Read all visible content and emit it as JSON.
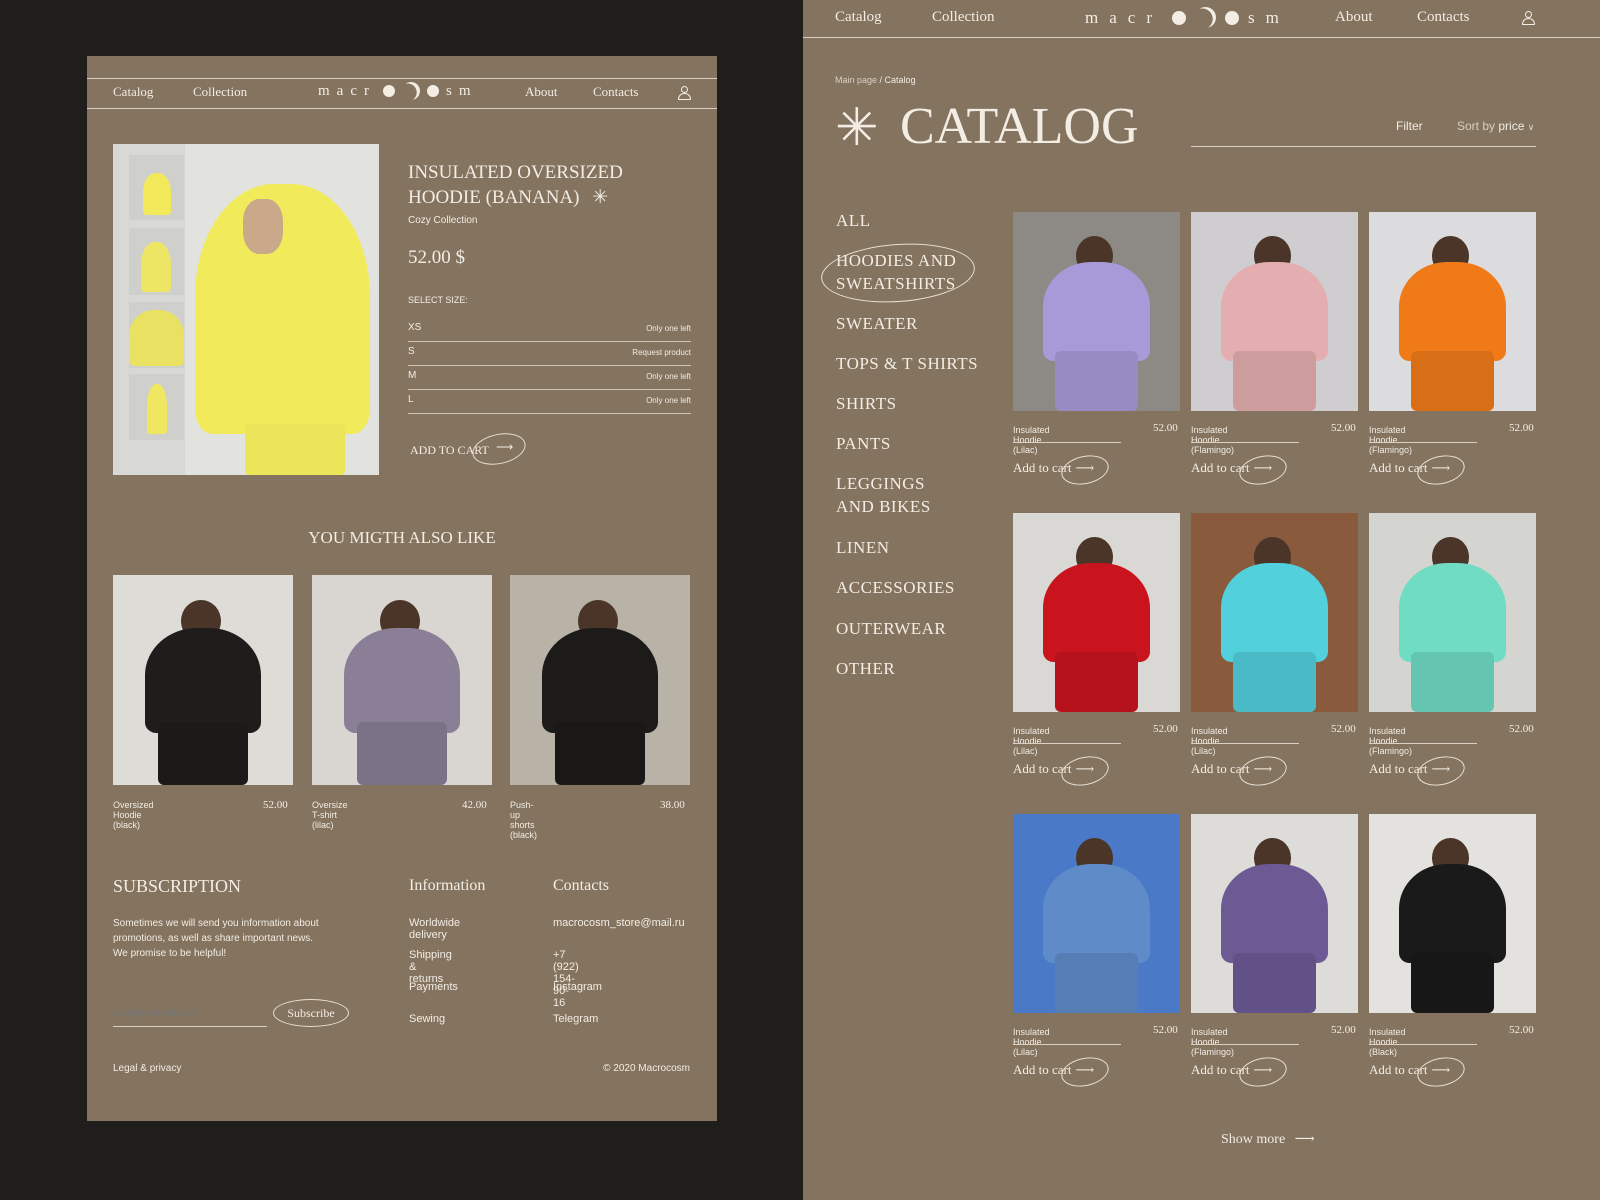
{
  "colors": {
    "background": "#1f1e1d",
    "panel": "#83735f",
    "text": "#f3ede4"
  },
  "nav": {
    "catalog": "Catalog",
    "collection": "Collection",
    "about": "About",
    "contacts": "Contacts",
    "logo_left": "macr",
    "logo_right": "sm",
    "user_icon": "user-icon"
  },
  "product": {
    "title_line1": "INSULATED OVERSIZED",
    "title_line2": "HOODIE (BANANA)",
    "collection": "Cozy Collection",
    "price": "52.00 $",
    "select_size": "SELECT SIZE:",
    "sizes": [
      {
        "size": "XS",
        "status": "Only one left"
      },
      {
        "size": "S",
        "status": "Request product"
      },
      {
        "size": "M",
        "status": "Only one left"
      },
      {
        "size": "L",
        "status": "Only one left"
      }
    ],
    "add_to_cart": "ADD TO CART"
  },
  "also_like": {
    "title": "YOU MIGTH ALSO LIKE",
    "items": [
      {
        "name": "Oversized Hoodie (black)",
        "price": "52.00",
        "color": "#1e1d1c",
        "bg": "#dedcd7"
      },
      {
        "name": "Oversize T-shirt (lilac)",
        "price": "42.00",
        "color": "#8a7f96",
        "bg": "#d9d6d2"
      },
      {
        "name": "Push-up shorts (black)",
        "price": "38.00",
        "color": "#1c1b1a",
        "bg": "#b9b2a6"
      }
    ]
  },
  "footer": {
    "subscription_title": "SUBSCRIPTION",
    "subscription_text_1": "Sometimes we will send you information about",
    "subscription_text_2": "promotions, as well as share important news.",
    "subscription_text_3": "We promise to be helpful!",
    "email_placeholder": "mail@example.com",
    "subscribe": "Subscribe",
    "information_title": "Information",
    "information": [
      "Worldwide delivery",
      "Shipping & returns",
      "Payments",
      "Sewing"
    ],
    "contacts_title": "Contacts",
    "contacts": [
      "macrocosm_store@mail.ru",
      "+7 (922) 154-90-16",
      "Instagram",
      "Telegram"
    ],
    "legal": "Legal & privacy",
    "copyright": "© 2020 Macrocosm"
  },
  "catalog": {
    "breadcrumb_main": "Main page",
    "breadcrumb_current": "/ Catalog",
    "title": "CATALOG",
    "filter": "Filter",
    "sort_prefix": "Sort by",
    "sort_value": "price",
    "categories": [
      "ALL",
      "HOODIES AND\nSWEATSHIRTS",
      "SWEATER",
      "TOPS & T SHIRTS",
      "SHIRTS",
      "PANTS",
      "LEGGINGS\nAND BIKES",
      "LINEN",
      "ACCESSORIES",
      "OUTERWEAR",
      "OTHER"
    ],
    "selected_category": 1,
    "add_to_cart": "Add to cart",
    "products": [
      {
        "name": "Insulated Hoodie (Lilac)",
        "price": "52.00",
        "color": "#a89ad8",
        "bg": "#8d8a85"
      },
      {
        "name": "Insulated Hoodie (Flamingo)",
        "price": "52.00",
        "color": "#e4aeb0",
        "bg": "#cfcdd0"
      },
      {
        "name": "Insulated Hoodie (Flamingo)",
        "price": "52.00",
        "color": "#f07a18",
        "bg": "#dcdcde"
      },
      {
        "name": "Insulated Hoodie (Lilac)",
        "price": "52.00",
        "color": "#c9141e",
        "bg": "#dad8d4"
      },
      {
        "name": "Insulated Hoodie (Lilac)",
        "price": "52.00",
        "color": "#52d0dc",
        "bg": "#8a5a3c"
      },
      {
        "name": "Insulated Hoodie (Flamingo)",
        "price": "52.00",
        "color": "#6fdcc3",
        "bg": "#d4d4d0"
      },
      {
        "name": "Insulated Hoodie (Lilac)",
        "price": "52.00",
        "color": "#5f8cc8",
        "bg": "#4a79c8"
      },
      {
        "name": "Insulated Hoodie (Flamingo)",
        "price": "52.00",
        "color": "#6d5a95",
        "bg": "#dedcd8"
      },
      {
        "name": "Insulated Hoodie (Black)",
        "price": "52.00",
        "color": "#1b1a1a",
        "bg": "#e4e2de"
      }
    ],
    "show_more": "Show more"
  }
}
